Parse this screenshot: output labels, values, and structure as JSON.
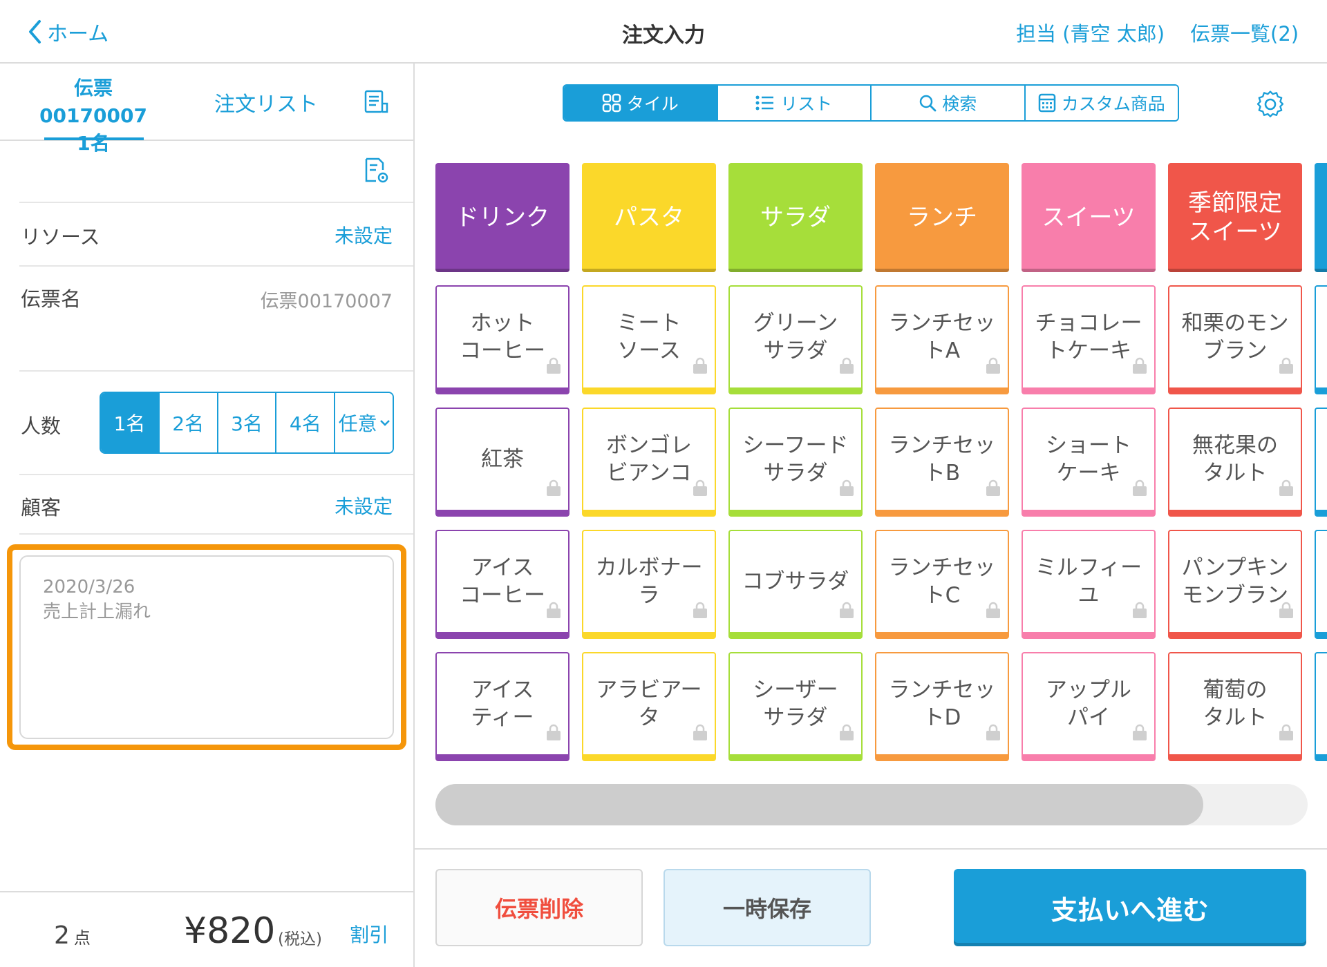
{
  "header": {
    "back_label": "ホーム",
    "title": "注文入力",
    "staff": "担当 (青空 太郎)",
    "slip_list": "伝票一覧(2)"
  },
  "left": {
    "tab_slip_id": "伝票00170007",
    "tab_slip_people": "1名",
    "tab_order_list": "注文リスト",
    "resource_label": "リソース",
    "resource_value": "未設定",
    "slip_name_label": "伝票名",
    "slip_name_value": "伝票00170007",
    "people_label": "人数",
    "people_options": [
      "1名",
      "2名",
      "3名",
      "4名",
      "任意"
    ],
    "people_selected": "1名",
    "customer_label": "顧客",
    "customer_value": "未設定",
    "memo": "2020/3/26\n売上計上漏れ",
    "item_count": "2",
    "item_count_unit": "点",
    "total": "¥820",
    "tax_label": "(税込)",
    "discount_label": "割引"
  },
  "view_modes": [
    "タイル",
    "リスト",
    "検索",
    "カスタム商品"
  ],
  "view_selected": "タイル",
  "categories": [
    {
      "label": "ドリンク",
      "color": "#8b44ae"
    },
    {
      "label": "パスタ",
      "color": "#fbd82a"
    },
    {
      "label": "サラダ",
      "color": "#a6de3a"
    },
    {
      "label": "ランチ",
      "color": "#f79a3f"
    },
    {
      "label": "スイーツ",
      "color": "#f87eab"
    },
    {
      "label": "季節限定\nスイーツ",
      "color": "#f0564a"
    },
    {
      "label": "",
      "color": "#1a9ed8"
    }
  ],
  "item_rows": [
    [
      "ホット\nコーヒー",
      "ミート\nソース",
      "グリーン\nサラダ",
      "ランチセッ\nトA",
      "チョコレー\nトケーキ",
      "和栗のモン\nブラン",
      ""
    ],
    [
      "紅茶",
      "ボンゴレ\nビアンコ",
      "シーフード\nサラダ",
      "ランチセッ\nトB",
      "ショート\nケーキ",
      "無花果の\nタルト",
      ""
    ],
    [
      "アイス\nコーヒー",
      "カルボナー\nラ",
      "コブサラダ",
      "ランチセッ\nトC",
      "ミルフィー\nユ",
      "パンプキン\nモンブラン",
      ""
    ],
    [
      "アイス\nティー",
      "アラビアー\nタ",
      "シーザー\nサラダ",
      "ランチセッ\nトD",
      "アップル\nパイ",
      "葡萄の\nタルト",
      ""
    ]
  ],
  "scroll_fraction": 0.88,
  "buttons": {
    "delete": "伝票削除",
    "hold": "一時保存",
    "pay": "支払いへ進む"
  },
  "colors": {
    "accent": "#1a9ed8",
    "memo_highlight": "#f5960a",
    "delete_text": "#f04e3e"
  }
}
